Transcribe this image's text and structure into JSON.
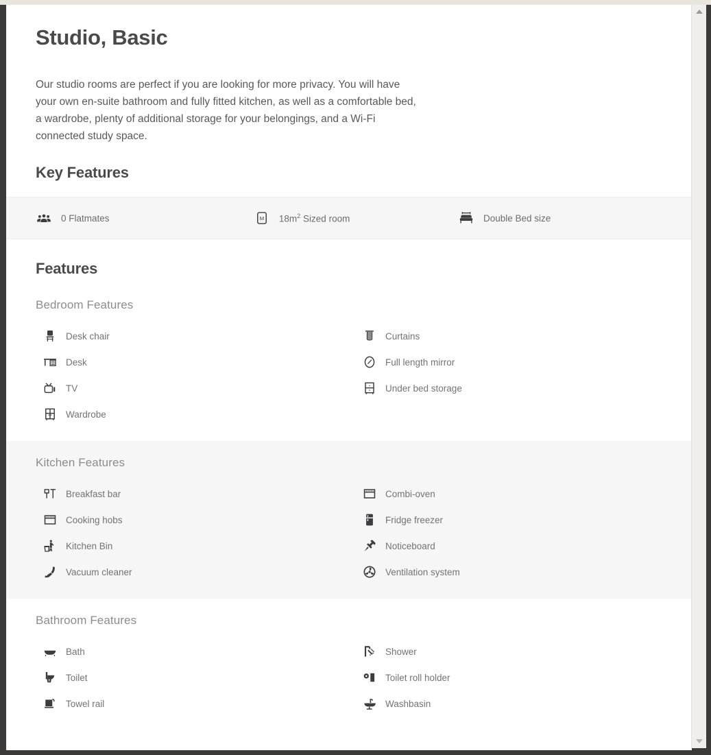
{
  "page": {
    "title": "Studio, Basic",
    "intro": "Our studio rooms are perfect if you are looking for more privacy. You will have your own en-suite bathroom and fully fitted kitchen, as well as a comfortable bed, a wardrobe, plenty of additional storage for your belongings, and a Wi-Fi connected study space.",
    "key_features_heading": "Key Features",
    "features_heading": "Features"
  },
  "colors": {
    "page_background": "#ffffff",
    "band_grey": "#f6f6f6",
    "heading_text": "#4a4a4a",
    "body_text": "#58585a",
    "muted_text": "#737375",
    "section_title": "#8c8c8e",
    "icon": "#3d3d3f",
    "chrome": "#3b3a38",
    "top_strip": "#e9e5dd",
    "scrollbar_track": "#efeeed"
  },
  "key_features": [
    {
      "icon": "people-icon",
      "value": "0",
      "unit": "",
      "sup": "",
      "label": "Flatmates",
      "text": "0 Flatmates"
    },
    {
      "icon": "room-size-m-icon",
      "value": "18m",
      "unit": "",
      "sup": "2",
      "label": "Sized room",
      "text": "18m2 Sized room"
    },
    {
      "icon": "bed-icon",
      "value": "Double",
      "unit": "",
      "sup": "",
      "label": "Bed size",
      "text": "Double Bed size"
    }
  ],
  "feature_sections": [
    {
      "title": "Bedroom Features",
      "background": "white",
      "left": [
        {
          "icon": "desk-chair-icon",
          "label": "Desk chair"
        },
        {
          "icon": "desk-icon",
          "label": "Desk"
        },
        {
          "icon": "tv-icon",
          "label": "TV"
        },
        {
          "icon": "wardrobe-icon",
          "label": "Wardrobe"
        }
      ],
      "right": [
        {
          "icon": "curtains-icon",
          "label": "Curtains"
        },
        {
          "icon": "mirror-icon",
          "label": "Full length mirror"
        },
        {
          "icon": "under-bed-storage-icon",
          "label": "Under bed storage"
        }
      ]
    },
    {
      "title": "Kitchen Features",
      "background": "grey",
      "left": [
        {
          "icon": "breakfast-bar-icon",
          "label": "Breakfast bar"
        },
        {
          "icon": "cooking-hobs-icon",
          "label": "Cooking hobs"
        },
        {
          "icon": "kitchen-bin-icon",
          "label": "Kitchen Bin"
        },
        {
          "icon": "vacuum-cleaner-icon",
          "label": "Vacuum cleaner"
        }
      ],
      "right": [
        {
          "icon": "combi-oven-icon",
          "label": "Combi-oven"
        },
        {
          "icon": "fridge-freezer-icon",
          "label": "Fridge freezer"
        },
        {
          "icon": "noticeboard-icon",
          "label": "Noticeboard"
        },
        {
          "icon": "ventilation-system-icon",
          "label": "Ventilation system"
        }
      ]
    },
    {
      "title": "Bathroom Features",
      "background": "white",
      "left": [
        {
          "icon": "bath-icon",
          "label": "Bath"
        },
        {
          "icon": "toilet-icon",
          "label": "Toilet"
        },
        {
          "icon": "towel-rail-icon",
          "label": "Towel rail"
        }
      ],
      "right": [
        {
          "icon": "shower-icon",
          "label": "Shower"
        },
        {
          "icon": "toilet-roll-holder-icon",
          "label": "Toilet roll holder"
        },
        {
          "icon": "washbasin-icon",
          "label": "Washbasin"
        }
      ]
    }
  ],
  "scrollbar": {
    "up_arrow": "scroll-up",
    "down_arrow": "scroll-down"
  }
}
